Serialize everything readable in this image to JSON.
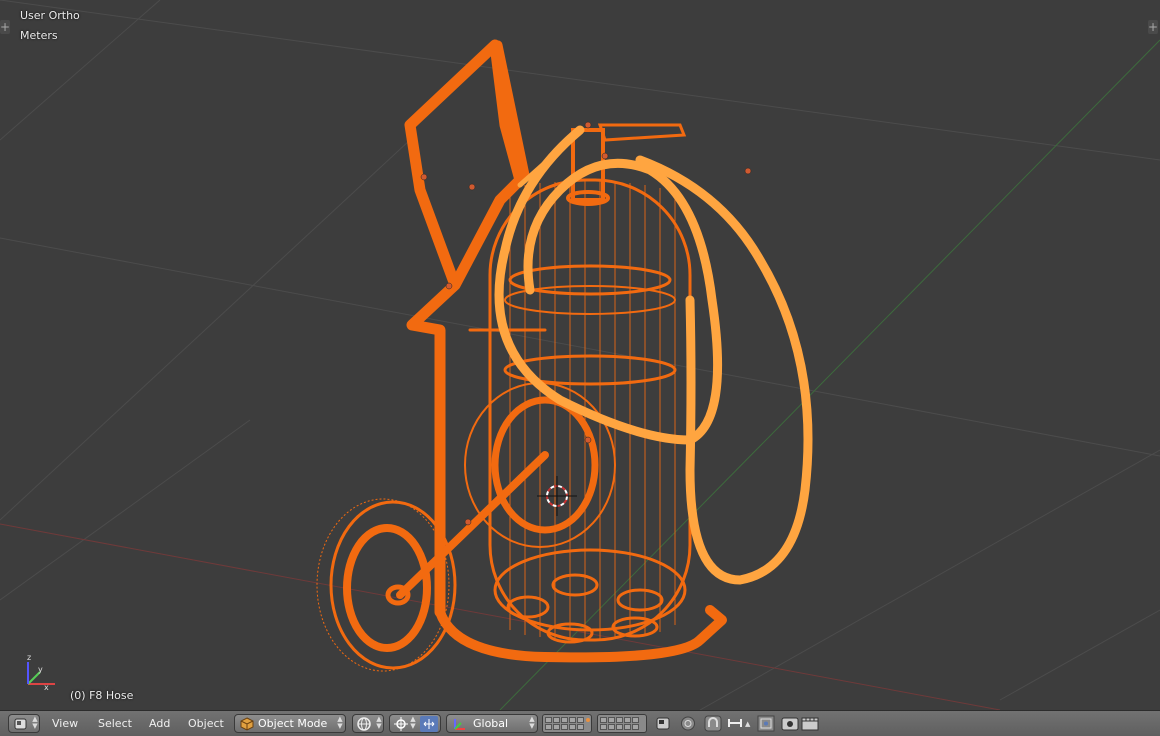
{
  "viewport": {
    "view_name": "User Ortho",
    "units": "Meters",
    "selection_info": "(0) F8 Hose"
  },
  "header": {
    "editor_type_icon": "3d-view-icon",
    "menus": [
      "View",
      "Select",
      "Add",
      "Object"
    ],
    "mode": {
      "icon": "cube-icon",
      "label": "Object Mode"
    },
    "shading_icon": "sphere-shading-icon",
    "pivot_icon": "pivot-point-icon",
    "manipulator_icon": "manipulator-icon",
    "orientation": {
      "icon": "orientation-icon",
      "label": "Global"
    },
    "layers_icon": "layer-grid",
    "extra_icons": [
      "lock-icon",
      "proportional-edit-icon",
      "snap-icon",
      "snap-element-icon",
      "opengl-render-icon",
      "render-animation-icon"
    ]
  },
  "colors": {
    "background": "#3d3d3d",
    "selected_orange": "#f26a10",
    "active_light_orange": "#ffa540",
    "header": "#6b6b6b"
  }
}
